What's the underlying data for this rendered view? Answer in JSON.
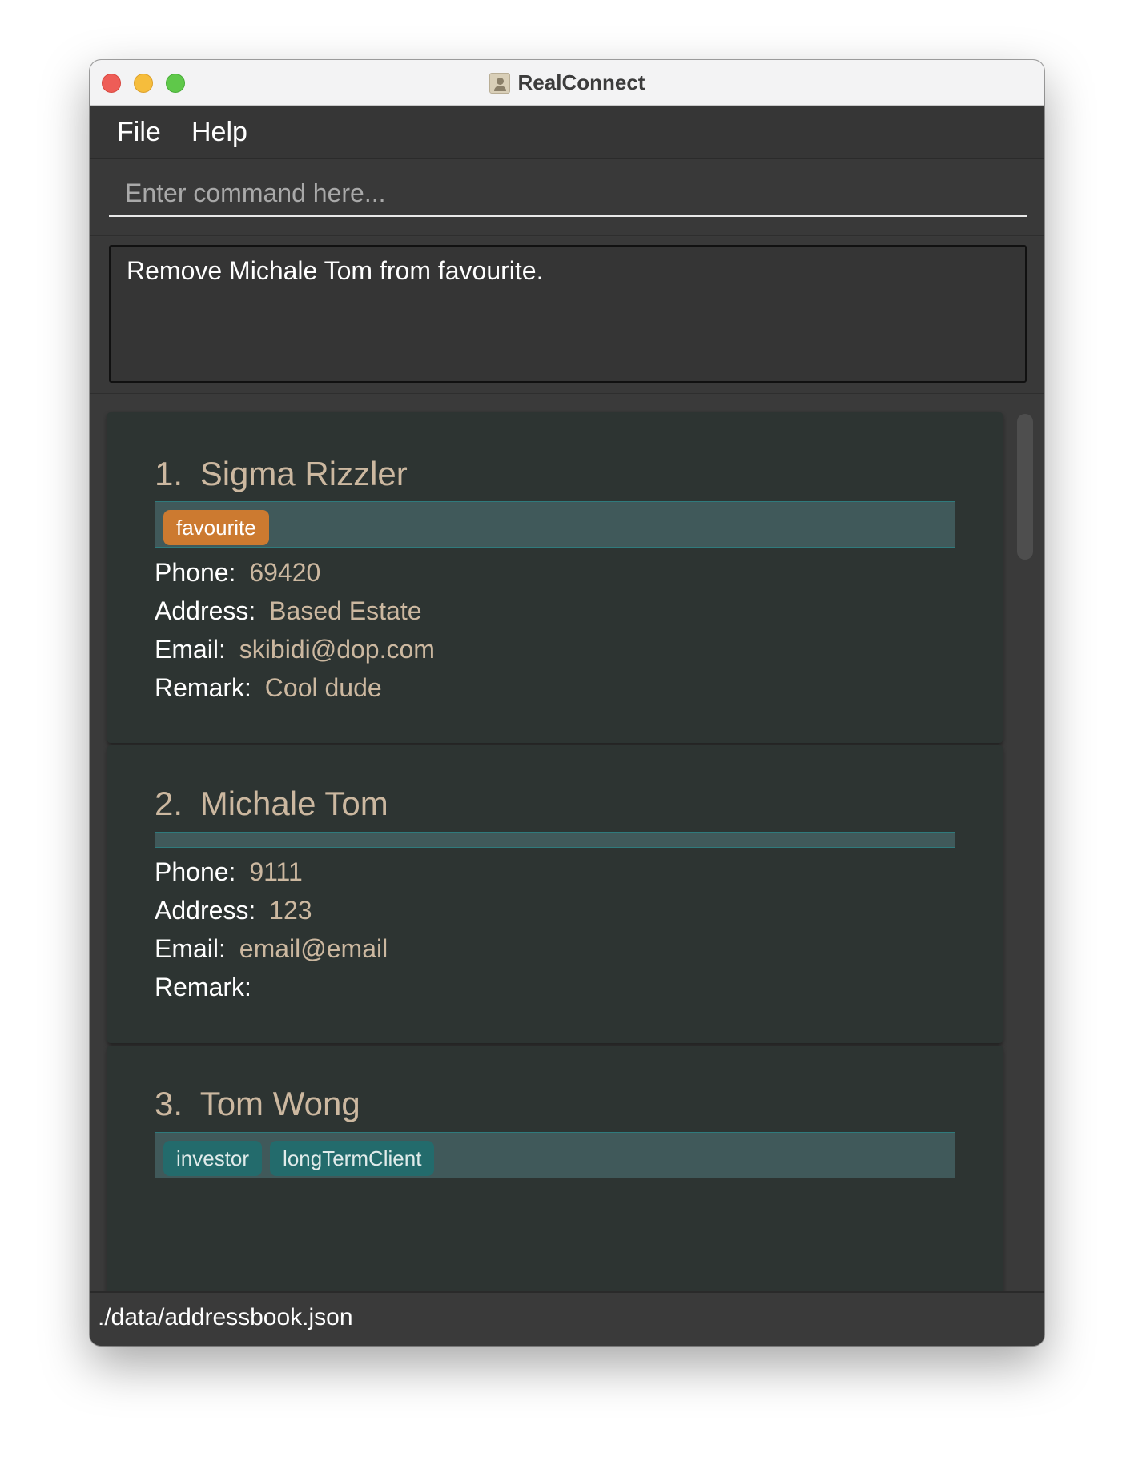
{
  "window": {
    "title": "RealConnect"
  },
  "menu": {
    "file": "File",
    "help": "Help"
  },
  "command": {
    "value": "",
    "placeholder": "Enter command here..."
  },
  "result": {
    "message": "Remove Michale Tom from favourite."
  },
  "persons": [
    {
      "index": "1.",
      "name": "Sigma Rizzler",
      "tags": [
        "favourite"
      ],
      "phone_label": "Phone:",
      "phone": "69420",
      "address_label": "Address:",
      "address": "Based Estate",
      "email_label": "Email:",
      "email": "skibidi@dop.com",
      "remark_label": "Remark:",
      "remark": "Cool dude"
    },
    {
      "index": "2.",
      "name": "Michale Tom",
      "tags": [],
      "phone_label": "Phone:",
      "phone": "9111",
      "address_label": "Address:",
      "address": "123",
      "email_label": "Email:",
      "email": "email@email",
      "remark_label": "Remark:",
      "remark": ""
    },
    {
      "index": "3.",
      "name": "Tom Wong",
      "tags": [
        "investor",
        "longTermClient"
      ]
    }
  ],
  "status": {
    "file_path": "./data/addressbook.json"
  },
  "colors": {
    "accent_value": "#ccb8a0",
    "favourite_tag": "#cc7a30",
    "normal_tag": "#236b6c",
    "card_bg": "#2d3432"
  },
  "icons": {
    "app": "contacts-book-icon"
  }
}
